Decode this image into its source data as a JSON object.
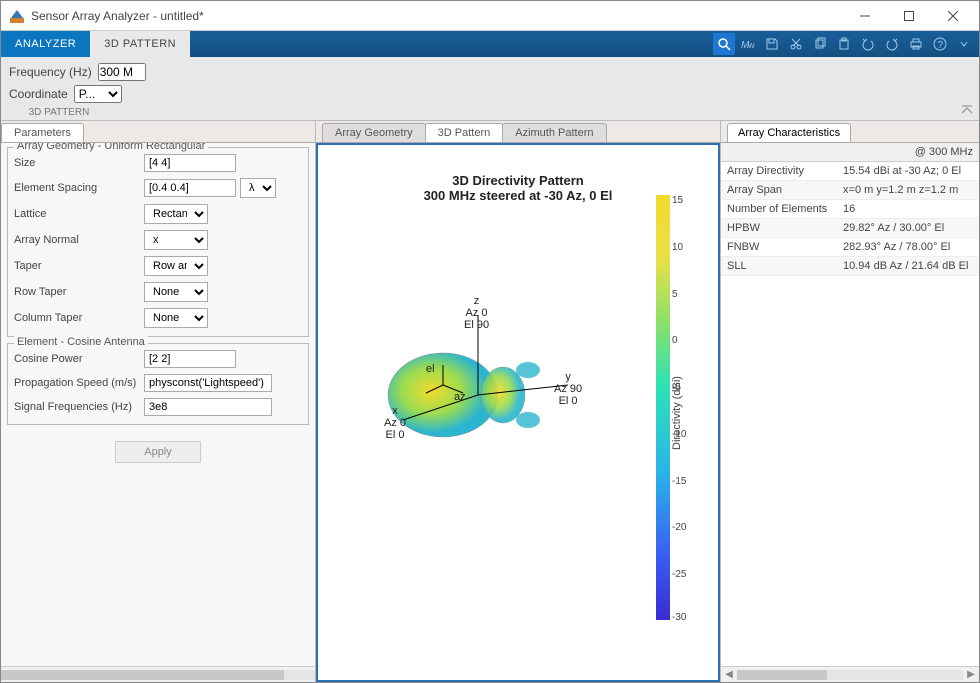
{
  "window": {
    "title": "Sensor Array Analyzer - untitled*"
  },
  "toolstrip": {
    "tabs": [
      "ANALYZER",
      "3D PATTERN"
    ]
  },
  "ribbon": {
    "freq_label": "Frequency (Hz)",
    "freq_value": "300 M",
    "coord_label": "Coordinate",
    "coord_value": "P...",
    "section": "3D PATTERN"
  },
  "left": {
    "tab": "Parameters",
    "group1": {
      "legend": "Array Geometry - Uniform Rectangular",
      "rows": [
        {
          "label": "Size",
          "value": "[4 4]"
        },
        {
          "label": "Element Spacing",
          "value": "[0.4 0.4]",
          "unit": "λ"
        },
        {
          "label": "Lattice",
          "value": "Rectang..."
        },
        {
          "label": "Array Normal",
          "value": "x"
        },
        {
          "label": "Taper",
          "value": "Row and..."
        },
        {
          "label": "Row Taper",
          "value": "None"
        },
        {
          "label": "Column Taper",
          "value": "None"
        }
      ]
    },
    "group2": {
      "legend": "Element - Cosine Antenna",
      "rows": [
        {
          "label": "Cosine Power",
          "value": "[2 2]"
        },
        {
          "label": "Propagation Speed (m/s)",
          "value": "physconst('Lightspeed')"
        },
        {
          "label": "Signal Frequencies (Hz)",
          "value": "3e8"
        }
      ]
    },
    "apply": "Apply"
  },
  "center": {
    "tabs": [
      "Array Geometry",
      "3D Pattern",
      "Azimuth Pattern"
    ],
    "active": 1,
    "title": "3D Directivity Pattern",
    "subtitle": "300 MHz steered at -30 Az, 0 El",
    "colorbar_label": "Directivity (dBi)",
    "ticks": [
      "15",
      "10",
      "5",
      "0",
      "-5",
      "-10",
      "-15",
      "-20",
      "-25",
      "-30"
    ],
    "axes": {
      "z": [
        "z",
        "Az 0",
        "El 90"
      ],
      "y": [
        "y",
        "Az 90",
        "El 0"
      ],
      "x": [
        "x",
        "Az 0",
        "El 0"
      ],
      "el": "el",
      "az": "az"
    }
  },
  "right": {
    "tab": "Array Characteristics",
    "col_header": "@ 300 MHz",
    "rows": [
      {
        "k": "Array Directivity",
        "v": "15.54 dBi at -30 Az; 0 El"
      },
      {
        "k": "Array Span",
        "v": "x=0 m y=1.2 m z=1.2 m"
      },
      {
        "k": "Number of Elements",
        "v": "16"
      },
      {
        "k": "HPBW",
        "v": "29.82° Az / 30.00° El"
      },
      {
        "k": "FNBW",
        "v": "282.93° Az / 78.00° El"
      },
      {
        "k": "SLL",
        "v": "10.94 dB Az / 21.64 dB El"
      }
    ]
  },
  "chart_data": {
    "type": "3d-radiation-pattern",
    "title": "3D Directivity Pattern",
    "subtitle": "300 MHz steered at -30 Az, 0 El",
    "colorbar": {
      "label": "Directivity (dBi)",
      "min": -30,
      "max": 15,
      "ticks": [
        15,
        10,
        5,
        0,
        -5,
        -10,
        -15,
        -20,
        -25,
        -30
      ]
    },
    "steering": {
      "az_deg": -30,
      "el_deg": 0,
      "freq_hz": 300000000.0
    },
    "peak_directivity_dBi": 15.54,
    "hpbw": {
      "az_deg": 29.82,
      "el_deg": 30.0
    },
    "fnbw": {
      "az_deg": 282.93,
      "el_deg": 78.0
    },
    "sll": {
      "az_dB": 10.94,
      "el_dB": 21.64
    },
    "axes": [
      {
        "name": "x",
        "az": 0,
        "el": 0
      },
      {
        "name": "y",
        "az": 90,
        "el": 0
      },
      {
        "name": "z",
        "az": 0,
        "el": 90
      }
    ]
  }
}
